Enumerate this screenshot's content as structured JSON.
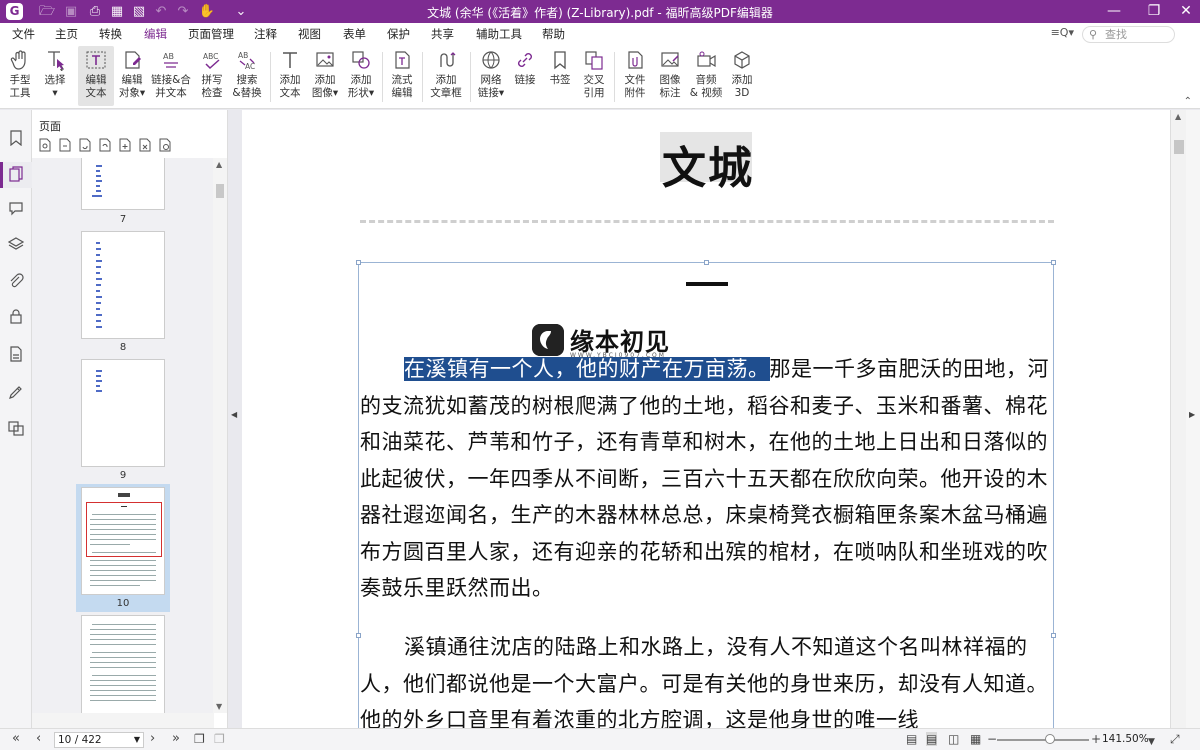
{
  "window": {
    "title": "文城 (余华 (《活着》作者) (Z-Library).pdf - 福昕高级PDF编辑器",
    "accent": "#7d2b91",
    "controls": [
      "minimize-icon",
      "restore-icon",
      "close-icon"
    ]
  },
  "menu": {
    "items": [
      "文件",
      "主页",
      "转换",
      "编辑",
      "页面管理",
      "注释",
      "视图",
      "表单",
      "保护",
      "共享",
      "辅助工具",
      "帮助"
    ],
    "active": "编辑",
    "search_placeholder": "查找"
  },
  "ribbon": {
    "tools": [
      {
        "label1": "手型",
        "label2": "工具",
        "icon": "hand-icon"
      },
      {
        "label1": "选择",
        "label2": "▾",
        "icon": "select-cursor-icon"
      },
      {
        "label1": "编辑",
        "label2": "文本",
        "icon": "edit-text-icon",
        "selected": true
      },
      {
        "label1": "编辑",
        "label2": "对象▾",
        "icon": "edit-object-icon"
      },
      {
        "label1": "链接&合",
        "label2": "并文本",
        "icon": "link-merge-text-icon"
      },
      {
        "label1": "拼写",
        "label2": "检查",
        "icon": "spell-check-icon"
      },
      {
        "label1": "搜索",
        "label2": "&替换",
        "icon": "search-replace-icon"
      },
      {
        "label1": "添加",
        "label2": "文本",
        "icon": "add-text-icon"
      },
      {
        "label1": "添加",
        "label2": "图像▾",
        "icon": "add-image-icon"
      },
      {
        "label1": "添加",
        "label2": "形状▾",
        "icon": "add-shape-icon"
      },
      {
        "label1": "流式",
        "label2": "编辑",
        "icon": "flow-edit-icon"
      },
      {
        "label1": "添加",
        "label2": "文章框",
        "icon": "article-box-icon"
      },
      {
        "label1": "网络",
        "label2": "链接▾",
        "icon": "web-link-icon"
      },
      {
        "label1": "链接",
        "label2": "",
        "icon": "link-icon"
      },
      {
        "label1": "书签",
        "label2": "",
        "icon": "bookmark-icon"
      },
      {
        "label1": "交叉",
        "label2": "引用",
        "icon": "cross-reference-icon"
      },
      {
        "label1": "文件",
        "label2": "附件",
        "icon": "file-attachment-icon"
      },
      {
        "label1": "图像",
        "label2": "标注",
        "icon": "image-annotation-icon"
      },
      {
        "label1": "音频",
        "label2": "& 视频",
        "icon": "audio-video-icon"
      },
      {
        "label1": "添加",
        "label2": "3D",
        "icon": "add-3d-icon"
      }
    ]
  },
  "sidebar": {
    "icons": [
      "bookmark-panel-icon",
      "pages-panel-icon",
      "comments-panel-icon",
      "layers-panel-icon",
      "attachments-panel-icon",
      "security-panel-icon",
      "form-panel-icon",
      "sign-panel-icon",
      "compare-panel-icon"
    ]
  },
  "pages_panel": {
    "title": "页面",
    "thumbnails": [
      {
        "number": "7"
      },
      {
        "number": "8"
      },
      {
        "number": "9"
      },
      {
        "number": "10",
        "selected": true
      },
      {
        "number": ""
      }
    ]
  },
  "document": {
    "title": "文城",
    "chapter": "一",
    "watermark": {
      "text": "缘本初见",
      "sub": "WWW.YBCJ0907.COM"
    },
    "paragraph1": {
      "highlighted": "在溪镇有一个人，他的财产在万亩荡。",
      "rest": "那是一千多亩肥沃的田地，河的支流犹如蓄茂的树根爬满了他的土地，稻谷和麦子、玉米和番薯、棉花和油菜花、芦苇和竹子，还有青草和树木，在他的土地上日出和日落似的此起彼伏，一年四季从不间断，三百六十五天都在欣欣向荣。他开设的木器社遐迩闻名，生产的木器林林总总，床桌椅凳衣橱箱匣条案木盆马桶遍布方圆百里人家，还有迎亲的花轿和出殡的棺材，在唢呐队和坐班戏的吹奏鼓乐里跃然而出。"
    },
    "paragraph2": "溪镇通往沈店的陆路上和水路上，没有人不知道这个名叫林祥福的人，他们都说他是一个大富户。可是有关他的身世来历，却没有人知道。他的外乡口音里有着浓重的北方腔调，这是他身世的唯一线"
  },
  "statusbar": {
    "page_display": "10 / 422",
    "zoom": "141.50%"
  }
}
